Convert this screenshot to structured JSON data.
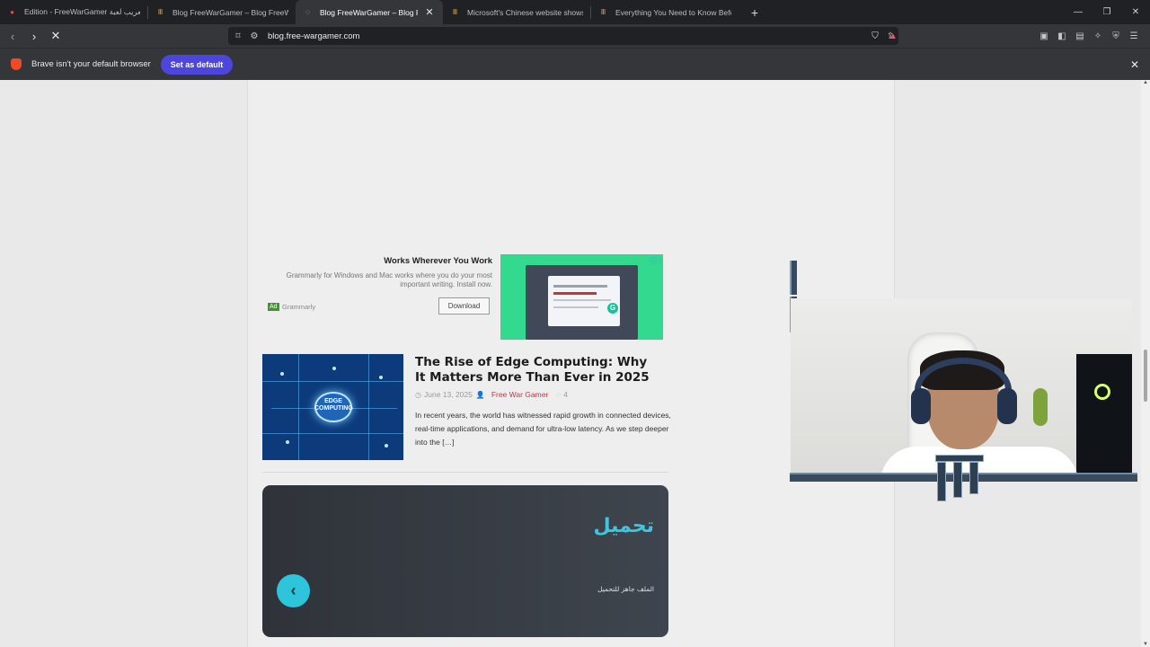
{
  "tabs": [
    {
      "title": "Edition - FreeWarGamer تعريب لعبة",
      "active": false
    },
    {
      "title": "Blog FreeWarGamer – Blog FreeWarG",
      "active": false
    },
    {
      "title": "Blog FreeWarGamer – Blog FreeW",
      "active": true
    },
    {
      "title": "Microsoft's Chinese website shows a",
      "active": false
    },
    {
      "title": "Everything You Need to Know Before",
      "active": false
    }
  ],
  "address_bar": {
    "url": "blog.free-wargamer.com"
  },
  "infobar": {
    "message": "Brave isn't your default browser",
    "button_label": "Set as default"
  },
  "ad": {
    "headline": "Works Wherever You Work",
    "description": "Grammarly for Windows and Mac works where you do your most important writing. Install now.",
    "ad_tag": "Ad",
    "brand": "Grammarly",
    "button_label": "Download"
  },
  "article": {
    "title": "The Rise of Edge Computing: Why It Matters More Than Ever in 2025",
    "date": "June 13, 2025",
    "author": "Free War Gamer",
    "comments": "4",
    "excerpt": "In recent years, the world has witnessed rapid growth in connected devices, real-time applications, and demand for ultra-low latency. As we step deeper into the […]",
    "thumb_text_1": "EDGE",
    "thumb_text_2": "COMPUTING"
  },
  "download_box": {
    "title": "تحميل",
    "subtitle": "الملف جاهز للتحميل"
  },
  "icons": {
    "back": "chevron-left-icon",
    "forward": "chevron-right-icon",
    "stop": "close-icon",
    "bookmark": "bookmark-icon",
    "share": "share-icon",
    "shield": "brave-shield-icon"
  },
  "colors": {
    "brand_button": "#4c46dd",
    "author": "#d1323e",
    "download_accent": "#40c4e0",
    "ad_image_bg": "#33d98f"
  }
}
